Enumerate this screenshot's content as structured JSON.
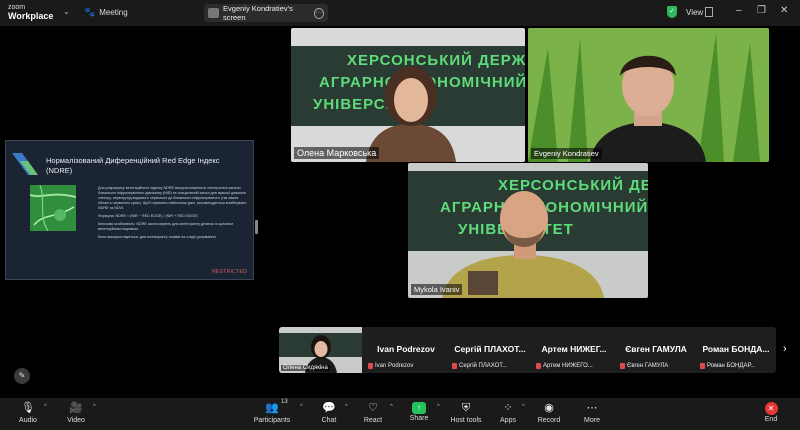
{
  "app": {
    "logo_top": "zoom",
    "logo_bottom": "Workplace"
  },
  "topbar": {
    "meeting_label": "Meeting",
    "share_label": "Evgeniy Kondratiev's screen",
    "view_label": "View"
  },
  "slide": {
    "title": "Нормалізований Диференційний Red Edge Індекс (NDRE)",
    "paragraphs": [
      "Для розрахунку вегетаційного індексу NDRE використовуються спектральні канали ближнього інфрачервоного діапазону (NIR) та спеціальний канал для вузької довжини спектру, перехід від видимого червоного до ближнього інфрачервоного (так звана область червоного краю). Щоб отримати найточніші дані, рекомендується комбінувати NDRE та NDVI.",
      "Формула: NDRE = (NIR − RED EDGE) / (NIR + RED EDGE)",
      "Ключова особливість: NDRE застосовують для моніторингу ділянок із щільним вегетаційним покривом.",
      "Коли використовується: для моніторингу посівів на стадії дозрівання."
    ],
    "restricted": "RESTRICTED"
  },
  "wall_text": {
    "t1": [
      "ХЕРСОНСЬКИЙ ДЕРЖАВНИЙ",
      "АГРАРНО-ЕКОНОМІЧНИЙ",
      "УНІВЕРСИТЕТ"
    ],
    "t3": [
      "ХЕРСОНСЬКИЙ ДЕРЖАВНИЙ",
      "АГРАРНО-ЕКОНОМІЧНИЙ",
      "УНІВЕРСИТЕТ"
    ]
  },
  "tiles": [
    {
      "name": "Олена Марковська"
    },
    {
      "name": "Evgeniy Kondratiev"
    },
    {
      "name": "Mykola Ivaniv"
    }
  ],
  "filmstrip": [
    {
      "name": "Олена Сидякіна"
    },
    {
      "big": "Ivan Podrezov",
      "small": "Ivan Podrezov"
    },
    {
      "big": "Сергій ПЛАХОТ...",
      "small": "Сергій ПЛАХОТ..."
    },
    {
      "big": "Артем НИЖЕГ...",
      "small": "Артем НИЖЕГО..."
    },
    {
      "big": "Євген ГАМУЛА",
      "small": "Євген ГАМУЛА"
    },
    {
      "big": "Роман БОНДА...",
      "small": "Роман БОНДАР..."
    }
  ],
  "toolbar": {
    "audio": "Audio",
    "video": "Video",
    "participants": "Participants",
    "participants_count": "13",
    "chat": "Chat",
    "react": "React",
    "share": "Share",
    "host_tools": "Host tools",
    "apps": "Apps",
    "record": "Record",
    "more": "More",
    "end": "End"
  },
  "colors": {
    "share_green": "#23c15b",
    "end_red": "#e53935",
    "restricted_red": "#c85a5a",
    "security_green": "#2fb95d"
  }
}
